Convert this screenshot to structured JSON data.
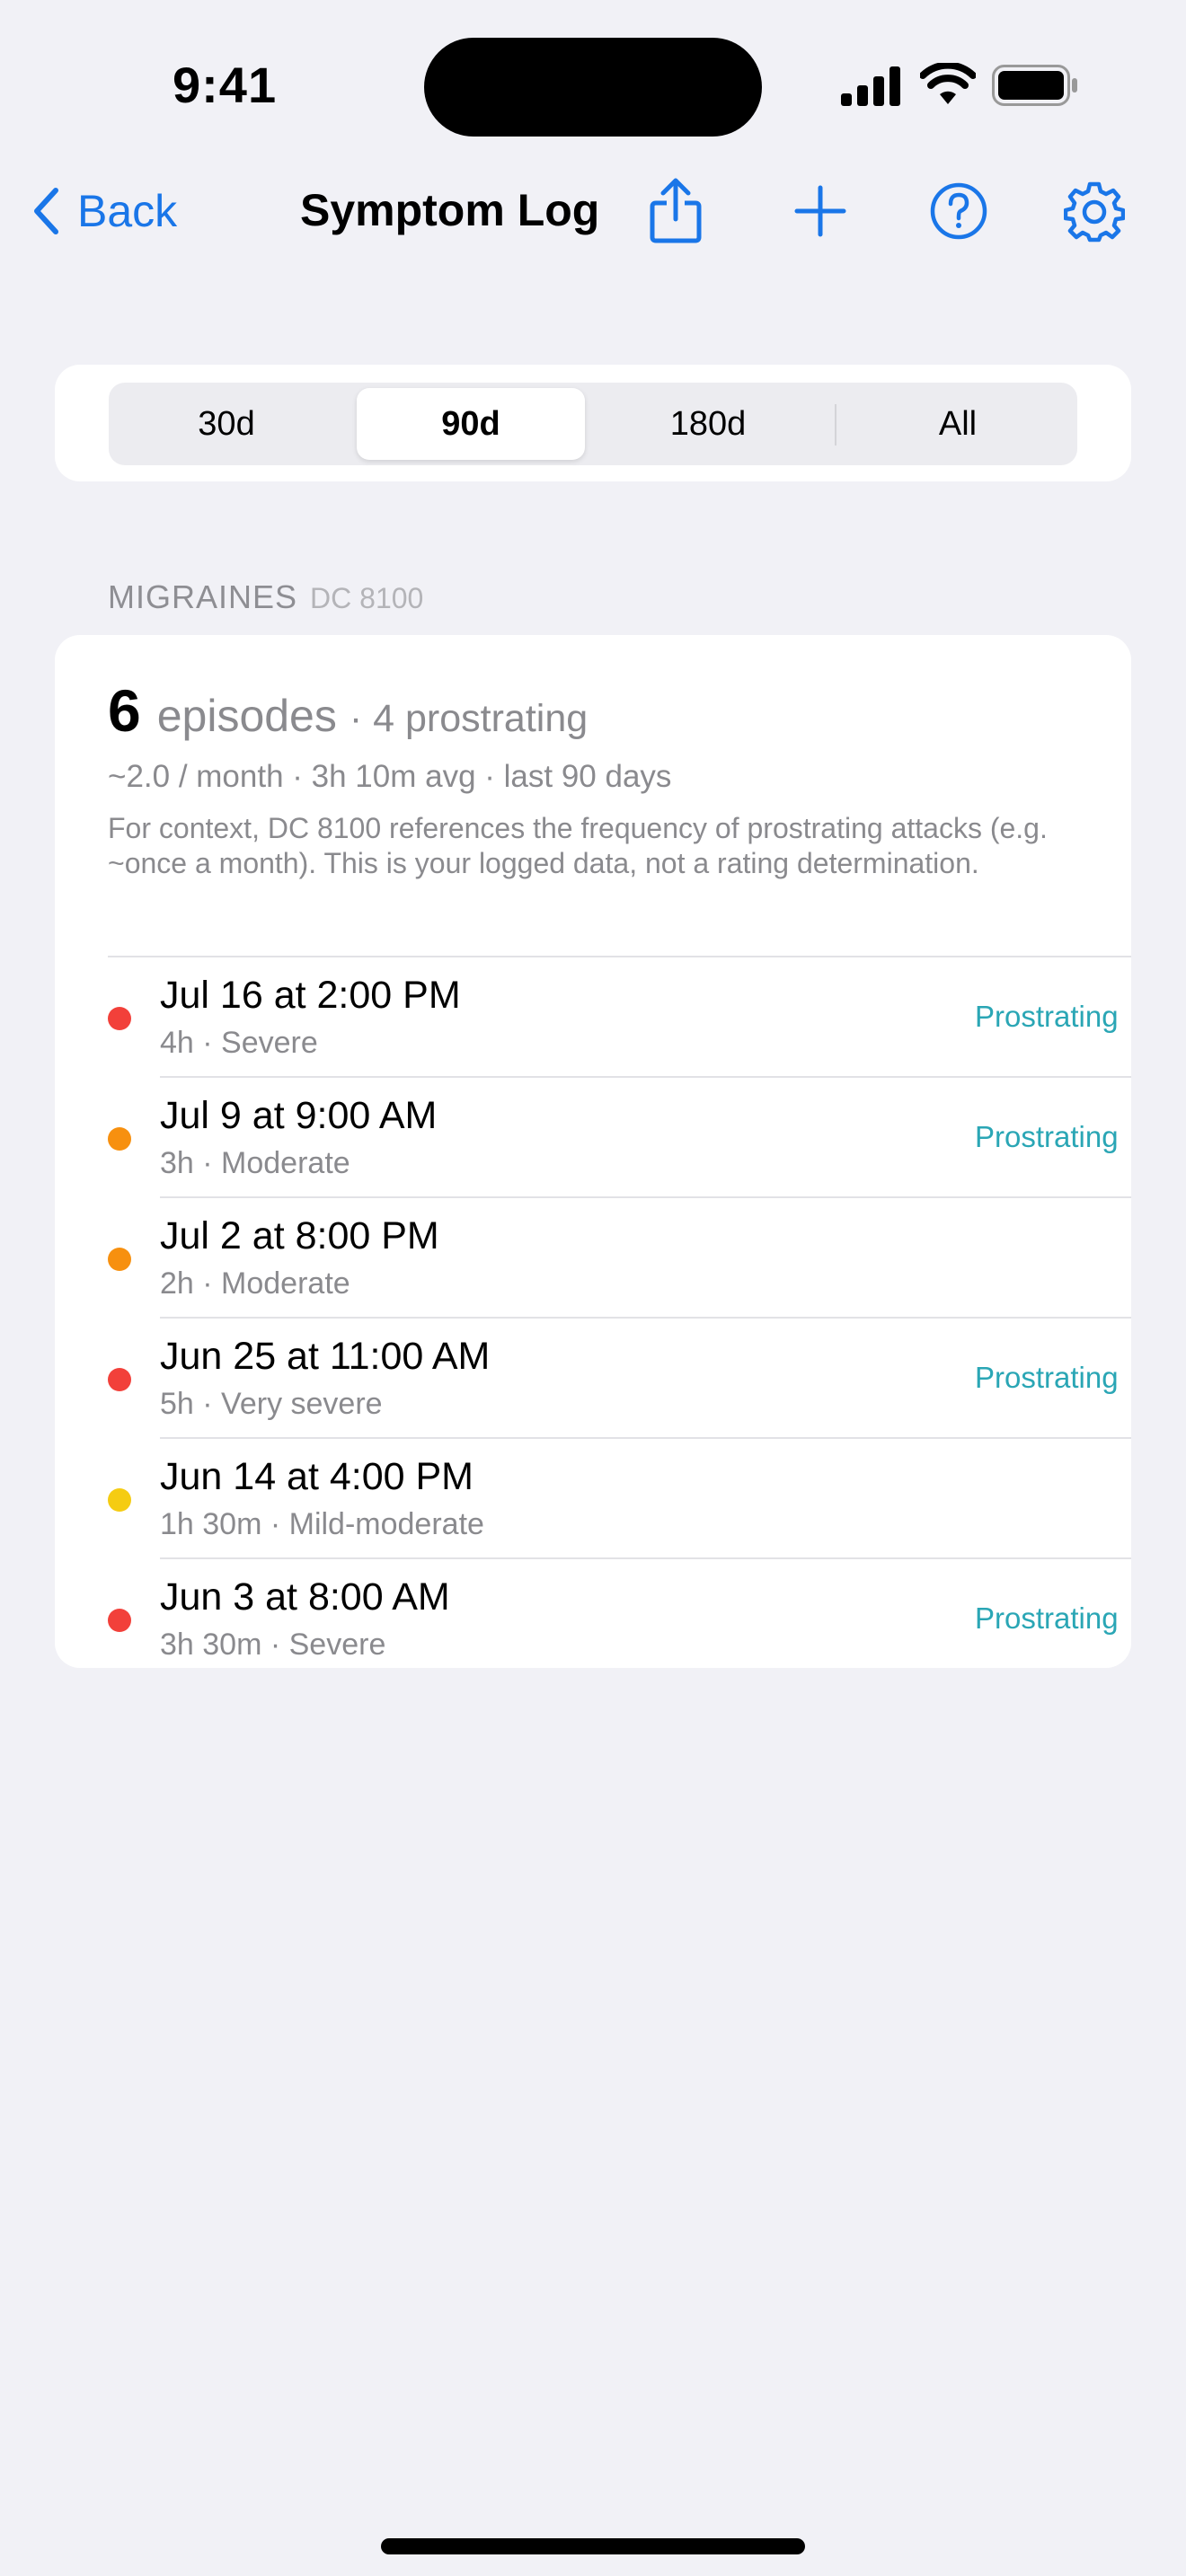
{
  "status_bar": {
    "time": "9:41"
  },
  "nav": {
    "back_label": "Back",
    "title": "Symptom Log",
    "icons": [
      "share-icon",
      "plus-icon",
      "help-icon",
      "gear-icon"
    ]
  },
  "segments": {
    "options": [
      "30d",
      "90d",
      "180d",
      "All"
    ],
    "selected": "90d"
  },
  "section": {
    "title": "MIGRAINES",
    "code": "DC 8100"
  },
  "summary": {
    "count": "6",
    "count_label": "episodes",
    "prostrating": "· 4 prostrating",
    "stats": "~2.0 / month · 3h 10m avg · last 90 days",
    "context": "For context, DC 8100 references the frequency of prostrating attacks (e.g. ~once a month). This is your logged data, not a rating determination."
  },
  "entries": [
    {
      "title": "Jul 16 at 2:00 PM",
      "subtitle": "4h · Severe",
      "tag": "Prostrating",
      "color": "#f2403a"
    },
    {
      "title": "Jul 9 at 9:00 AM",
      "subtitle": "3h · Moderate",
      "tag": "Prostrating",
      "color": "#f7900f"
    },
    {
      "title": "Jul 2 at 8:00 PM",
      "subtitle": "2h · Moderate",
      "tag": "",
      "color": "#f7900f"
    },
    {
      "title": "Jun 25 at 11:00 AM",
      "subtitle": "5h · Very severe",
      "tag": "Prostrating",
      "color": "#f2403a"
    },
    {
      "title": "Jun 14 at 4:00 PM",
      "subtitle": "1h 30m · Mild-moderate",
      "tag": "",
      "color": "#f5cc12"
    },
    {
      "title": "Jun 3 at 8:00 AM",
      "subtitle": "3h 30m · Severe",
      "tag": "Prostrating",
      "color": "#f2403a"
    }
  ],
  "colors": {
    "accent": "#1a76e8",
    "tag": "#2aa6b5"
  }
}
